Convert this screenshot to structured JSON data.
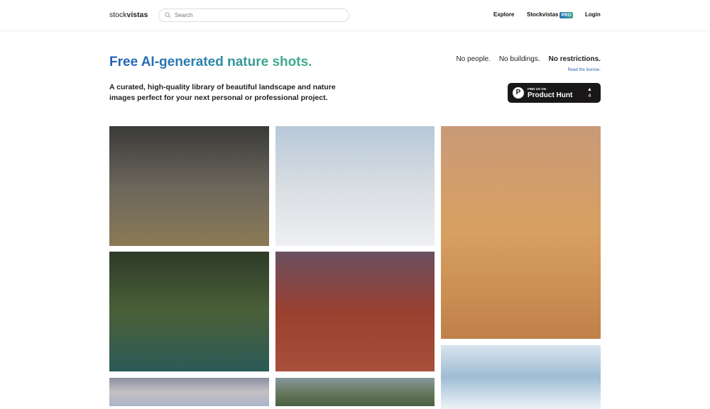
{
  "header": {
    "logo_light": "stock",
    "logo_bold": "vistas",
    "search_placeholder": "Search",
    "nav": {
      "explore": "Explore",
      "pro_label": "Stockvistas",
      "pro_badge": "PRO",
      "login": "Login"
    }
  },
  "hero": {
    "title": "Free AI-generated nature shots.",
    "subtitle": "A curated, high-quality library of beautiful landscape and nature images perfect for your next personal or professional project.",
    "tags": [
      "No people.",
      "No buildings.",
      "No restrictions."
    ],
    "license_link": "Read the license.",
    "product_hunt": {
      "find_label": "FIND US ON",
      "name": "Product Hunt",
      "upvotes": "4"
    }
  },
  "gallery": [
    {
      "name": "savanna-acacia-trees-image",
      "colors": [
        "#3a3a38",
        "#6b665c",
        "#8a7a55"
      ]
    },
    {
      "name": "salt-flat-mountains-image",
      "colors": [
        "#b8c8d8",
        "#d8dde2",
        "#eef0f2"
      ]
    },
    {
      "name": "coastal-sea-stacks-image",
      "colors": [
        "#c99a78",
        "#d8a060",
        "#c08048"
      ]
    },
    {
      "name": "jungle-cave-waterfall-image",
      "colors": [
        "#2d3a28",
        "#4a6038",
        "#2c5a58"
      ]
    },
    {
      "name": "red-desert-rock-image",
      "colors": [
        "#6a5060",
        "#9a4030",
        "#a8503a"
      ]
    },
    {
      "name": "ice-cave-image",
      "colors": [
        "#d8e4ee",
        "#9fbcd4",
        "#eef3f7"
      ]
    },
    {
      "name": "cloudy-sky-image",
      "colors": [
        "#8c8ea0",
        "#c4c0c4",
        "#aab4c8"
      ]
    },
    {
      "name": "green-hills-image",
      "colors": [
        "#8898a0",
        "#6a7a60",
        "#4a6040"
      ]
    }
  ]
}
